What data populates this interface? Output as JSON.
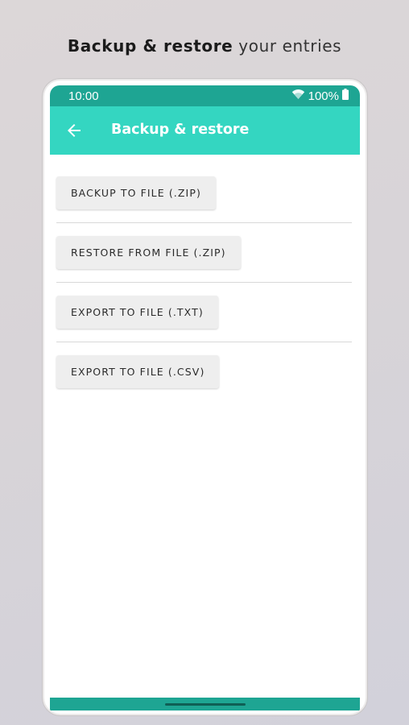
{
  "headline": {
    "bold": "Backup & restore",
    "rest": "your entries"
  },
  "statusbar": {
    "time": "10:00",
    "battery": "100%",
    "icons": [
      "wifi-icon",
      "battery-icon"
    ]
  },
  "appbar": {
    "title": "Backup & restore",
    "back_icon": "arrow-left-icon"
  },
  "actions": [
    {
      "label": "BACKUP TO FILE (.ZIP)"
    },
    {
      "label": "RESTORE FROM FILE (.ZIP)"
    },
    {
      "label": "EXPORT TO FILE (.TXT)"
    },
    {
      "label": "EXPORT TO FILE (.CSV)"
    }
  ],
  "colors": {
    "statusbar": "#1ea593",
    "appbar": "#34d6c1",
    "button_bg": "#eeeeee",
    "navbar": "#1ea593"
  }
}
